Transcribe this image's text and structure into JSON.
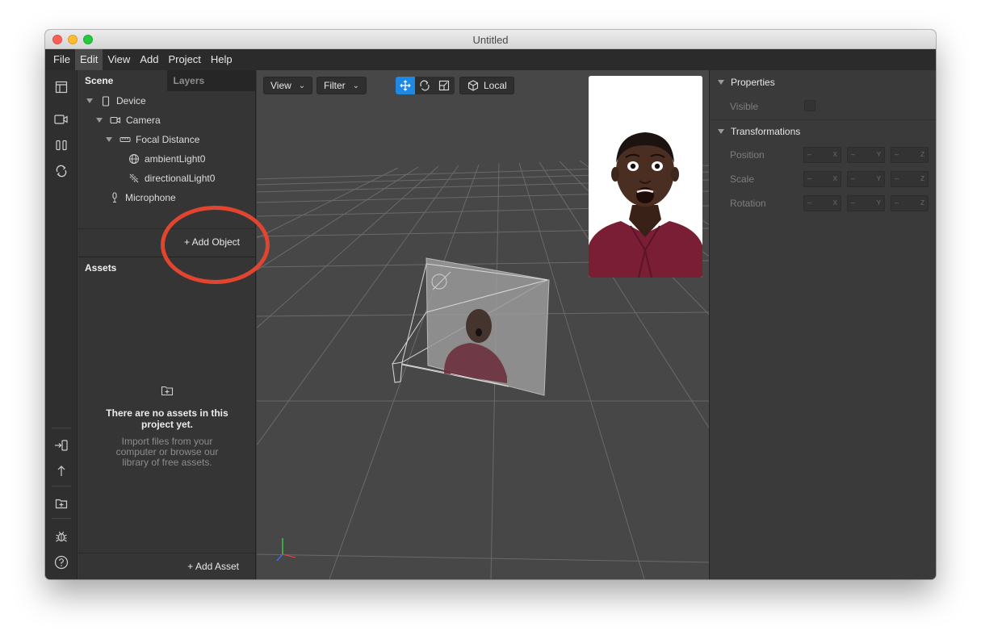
{
  "window": {
    "title": "Untitled"
  },
  "menu": [
    "File",
    "Edit",
    "View",
    "Add",
    "Project",
    "Help"
  ],
  "scene_panel": {
    "tabs": [
      "Scene",
      "Layers"
    ],
    "tree": [
      {
        "label": "Device",
        "icon": "device-icon",
        "depth": 0,
        "expanded": true
      },
      {
        "label": "Camera",
        "icon": "camera-icon",
        "depth": 1,
        "expanded": true
      },
      {
        "label": "Focal Distance",
        "icon": "focal-distance-icon",
        "depth": 2,
        "expanded": true
      },
      {
        "label": "ambientLight0",
        "icon": "ambient-light-icon",
        "depth": 3
      },
      {
        "label": "directionalLight0",
        "icon": "directional-light-icon",
        "depth": 3
      },
      {
        "label": "Microphone",
        "icon": "microphone-icon",
        "depth": 1
      }
    ],
    "add_object": "+ Add Object"
  },
  "assets_panel": {
    "title": "Assets",
    "empty_title": "There are no assets in this project yet.",
    "empty_subtitle": "Import files from your computer or browse our library of free assets.",
    "add_asset": "+ Add Asset"
  },
  "viewport": {
    "view_dropdown": "View",
    "filter_dropdown": "Filter",
    "space_button": "Local",
    "active_tool": "move"
  },
  "properties": {
    "header": "Properties",
    "visible_label": "Visible",
    "transform_header": "Transformations",
    "rows": [
      {
        "label": "Position",
        "values": [
          "–",
          "–",
          "–"
        ]
      },
      {
        "label": "Scale",
        "values": [
          "–",
          "–",
          "–"
        ]
      },
      {
        "label": "Rotation",
        "values": [
          "–",
          "–",
          "–"
        ]
      }
    ],
    "axes": [
      "X",
      "Y",
      "Z"
    ]
  },
  "annotation": {
    "color": "#e2452f",
    "target": "add-object-button"
  }
}
